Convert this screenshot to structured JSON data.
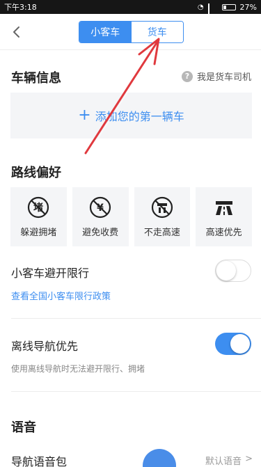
{
  "status_bar": {
    "time": "下午3:18",
    "battery": "27%"
  },
  "nav": {
    "tabs": [
      {
        "label": "小客车",
        "active": true
      },
      {
        "label": "货车",
        "active": false
      }
    ]
  },
  "vehicle": {
    "title": "车辆信息",
    "driver_label": "我是货车司机",
    "add_label": "添加您的第一辆车"
  },
  "route_pref": {
    "title": "路线偏好",
    "options": [
      {
        "label": "躲避拥堵",
        "icon": "avoid-congestion-icon"
      },
      {
        "label": "避免收费",
        "icon": "avoid-toll-icon"
      },
      {
        "label": "不走高速",
        "icon": "no-highway-icon"
      },
      {
        "label": "高速优先",
        "icon": "highway-priority-icon"
      }
    ]
  },
  "restriction": {
    "label": "小客车避开限行",
    "link": "查看全国小客车限行政策",
    "enabled": false
  },
  "offline": {
    "label": "离线导航优先",
    "desc": "使用离线导航时无法避开限行、拥堵",
    "enabled": true
  },
  "voice": {
    "title": "语音",
    "row_label": "导航语音包",
    "row_value": "默认语音"
  },
  "colors": {
    "accent": "#3d8ef0",
    "arrow": "#e0393e"
  }
}
